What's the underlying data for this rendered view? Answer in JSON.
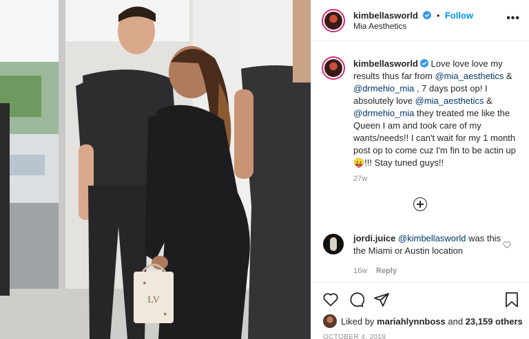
{
  "post": {
    "author": "kimbellasworld",
    "location": "Mia Aesthetics",
    "follow_label": "Follow",
    "more_label": "•••"
  },
  "caption": {
    "author": "kimbellasworld",
    "part1": " Love love love my results thus far from ",
    "mention1": "@mia_aesthetics",
    "part2": " & ",
    "mention2": "@drmehio_mia",
    "part3": " , 7 days post op! I absolutely love ",
    "mention3": "@mia_aesthetics",
    "part4": " & ",
    "mention4": "@drmehio_mia",
    "part5": " they treated me like the Queen I am and took care of my wants/needs!! I can't wait for my 1 month post op to come cuz I'm fin to be actin up ",
    "emoji": "😛",
    "part6": "!!! Stay tuned guys!!",
    "time": "27w"
  },
  "comment": {
    "author": "jordi.juice",
    "mention": "@kimbellasworld",
    "text": " was this the Miami or Austin location",
    "time": "16w",
    "reply_label": "Reply"
  },
  "likes": {
    "prefix": "Liked by ",
    "user": "mariahlynnboss",
    "middle": " and ",
    "count": "23,159 others"
  },
  "date": "OCTOBER 4, 2019",
  "colors": {
    "link": "#0095f6",
    "mention": "#00376b",
    "muted": "#8e8e8e",
    "ring": "#d62976"
  }
}
